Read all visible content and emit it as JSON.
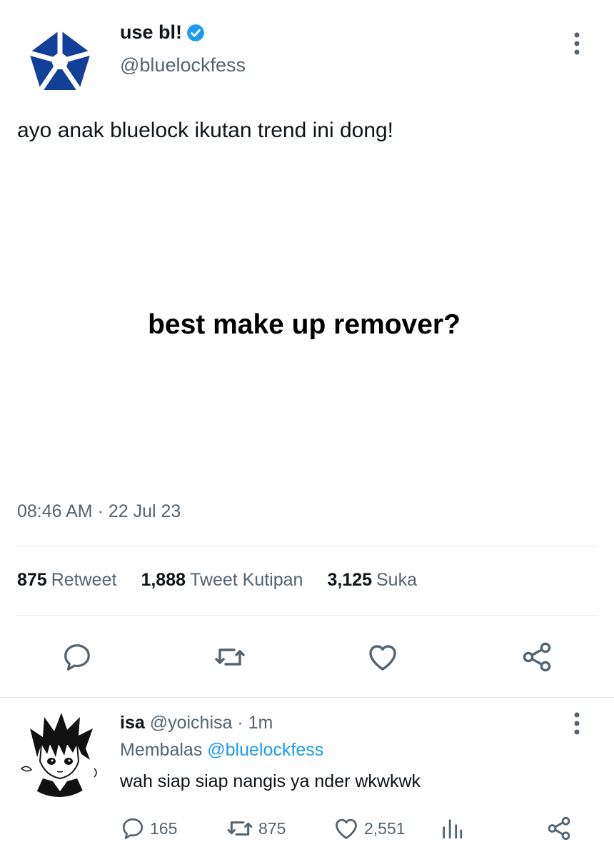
{
  "tweet": {
    "author_name": "use bl!",
    "author_handle": "@bluelockfess",
    "verified": true,
    "text": "ayo anak bluelock ikutan trend ini dong!",
    "image_text": "best make up remover?",
    "timestamp": "08:46 AM · 22 Jul 23",
    "stats": [
      {
        "value": "875",
        "label": "Retweet"
      },
      {
        "value": "1,888",
        "label": "Tweet Kutipan"
      },
      {
        "value": "3,125",
        "label": "Suka"
      }
    ],
    "actions": [
      "reply-icon",
      "retweet-icon",
      "like-icon",
      "share-icon"
    ]
  },
  "reply": {
    "author_name": "isa",
    "author_handle": "@yoichisa",
    "time": " · 1m",
    "replying_prefix": "Membalas ",
    "replying_to": "@bluelockfess",
    "text": "wah siap siap nangis ya nder wkwkwk",
    "counts": {
      "reply": "165",
      "retweet": "875",
      "like": "2,551"
    }
  },
  "colors": {
    "accent": "#1d9bf0",
    "logo_blue": "#123f97",
    "muted": "#536471",
    "text": "#0f1419",
    "divider": "#e6e9ec"
  }
}
